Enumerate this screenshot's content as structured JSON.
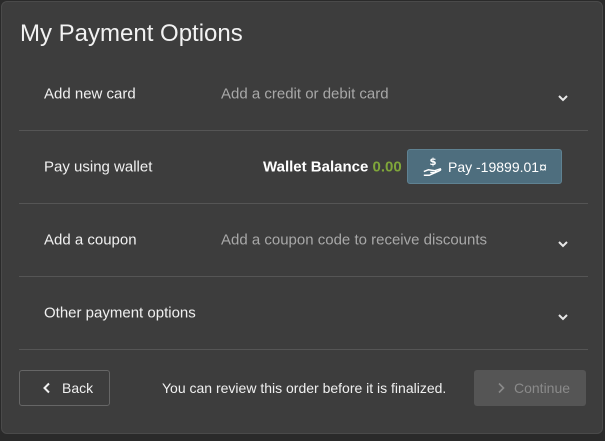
{
  "title": "My Payment Options",
  "rows": [
    {
      "label": "Add new card",
      "description": "Add a credit or debit card"
    },
    {
      "label": "Pay using wallet",
      "wallet_label": "Wallet Balance",
      "wallet_amount": "0.00",
      "pay_button": "Pay -19899.01¤"
    },
    {
      "label": "Add a coupon",
      "description": "Add a coupon code to receive discounts"
    },
    {
      "label": "Other payment options"
    }
  ],
  "footer": {
    "back_label": "Back",
    "note": "You can review this order before it is finalized.",
    "continue_label": "Continue"
  },
  "colors": {
    "panel_bg": "#3d3d3d",
    "pay_button_bg": "#4e6e7e",
    "wallet_amount": "#7fa63a",
    "continue_disabled_bg": "#555555"
  },
  "icons": {
    "chevron": "chevron-down-icon",
    "pay": "hand-dollar-icon",
    "back": "chevron-left-icon",
    "continue": "chevron-right-icon"
  }
}
